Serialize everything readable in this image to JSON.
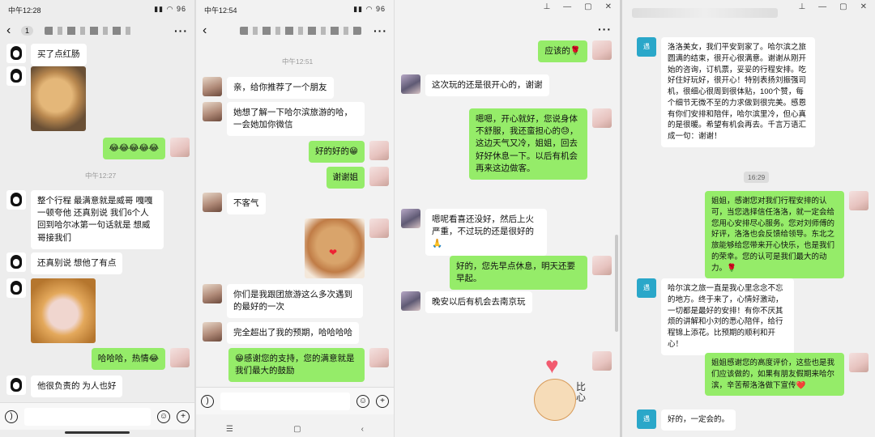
{
  "p1": {
    "status_time": "中午12:28",
    "status_right": "▮▮ ◠ 96",
    "badge": "1",
    "dots": "···",
    "msgs": [
      "买了点红肠",
      "😂😂😂😂😂",
      "整个行程 最满意就是威哥 嘎嘎一顿夸他 还真别说 我们6个人回到哈尔冰第一句话就是 想威哥接我们",
      "还真别说 想他了有点",
      "哈哈哈，热情😂",
      "他很负责的 为人也好"
    ],
    "time1": "中午12:27"
  },
  "p2": {
    "status_time": "中午12:54",
    "status_right": "▮▮ ◠ 96",
    "dots": "···",
    "time1": "中午12:51",
    "msgs": [
      "亲，给你推荐了一个朋友",
      "她想了解一下哈尔滨旅游的哈，一会她加你微信",
      "好的好的😁",
      "谢谢姐",
      "不客气",
      "你们是我跟团旅游这么多次遇到的最好的一次",
      "完全超出了我的预期，哈哈哈哈",
      "😁感谢您的支持，您的满意就是我们最大的鼓励"
    ],
    "navkeys": [
      "☰",
      "▢",
      "‹"
    ]
  },
  "p3": {
    "win_controls": [
      "⊥",
      "—",
      "▢",
      "✕"
    ],
    "dots": "···",
    "msgs": [
      "应该的🌹",
      "这次玩的还是很开心的，谢谢",
      "嗯嗯，开心就好，您说身体不舒服，我还蛮担心的😓，这边天气又冷，姐姐，回去好好休息一下。以后有机会再来这边做客。",
      "嗯呢看喜还没好，然后上火严重，不过玩的还是很好的🙏",
      "好的，您先早点休息，明天还要早起。",
      "晚安以后有机会去南京玩"
    ],
    "sticker_label": "比心"
  },
  "p4": {
    "win_controls": [
      "⊥",
      "—",
      "▢",
      "✕"
    ],
    "time_chip": "16:29",
    "msgs": [
      "洛洛美女，我们平安到家了。哈尔滨之旅圆满的结束，很开心很满意。谢谢从刚开始的咨询，订机票，妥妥的行程安排。吃好住好玩好，很开心！特别表扬刘振强司机，很细心很周到很体贴，100个赞，每个细节无微不至的力求做到很完美。感恩有你们安排和陪伴，哈尔滨里冷，但心真的是很暖。希望有机会再去。千言万语汇成一句：谢谢！",
      "姐姐，感谢您对我们行程安排的认可，当您选择信任洛洛，就一定会给您用心安排尽心服务。您对刘师傅的好评，洛洛也会反馈给领导。东北之旅能够给您带来开心快乐，也是我们的荣幸。您的认可是我们最大的动力。🌹",
      "哈尔滨之旅一直是我心里念念不忘的地方。终于来了，心情好激动，一切都是最好的安排！有你不厌其烦的讲解和小刘的悉心陪伴，给行程锦上添花。比预期的顺利和开心！",
      "姐姐感谢您的高度评价，这些也是我们应该做的，如果有朋友假期来哈尔滨，辛苦帮洛洛做下宣传❤️",
      "好的，一定会的。"
    ]
  }
}
